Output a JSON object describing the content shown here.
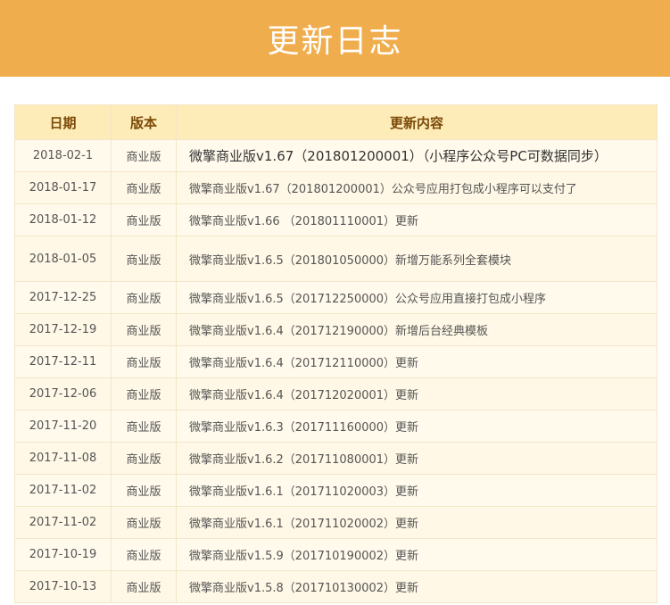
{
  "header": {
    "title": "更新日志"
  },
  "table": {
    "columns": [
      "日期",
      "版本",
      "更新内容"
    ],
    "rows": [
      {
        "date": "2018-02-1",
        "edition": "商业版",
        "content": "微擎商业版v1.67（201801200001）（小程序公众号PC可数据同步）"
      },
      {
        "date": "2018-01-17",
        "edition": "商业版",
        "content": "微擎商业版v1.67（201801200001）公众号应用打包成小程序可以支付了"
      },
      {
        "date": "2018-01-12",
        "edition": "商业版",
        "content": "微擎商业版v1.66 （201801110001）更新"
      },
      {
        "date": "2018-01-05",
        "edition": "商业版",
        "content": "微擎商业版v1.6.5（201801050000）新增万能系列全套模块"
      },
      {
        "date": "2017-12-25",
        "edition": "商业版",
        "content": "微擎商业版v1.6.5（201712250000）公众号应用直接打包成小程序"
      },
      {
        "date": "2017-12-19",
        "edition": "商业版",
        "content": "微擎商业版v1.6.4（201712190000）新增后台经典模板"
      },
      {
        "date": "2017-12-11",
        "edition": "商业版",
        "content": "微擎商业版v1.6.4（201712110000）更新"
      },
      {
        "date": "2017-12-06",
        "edition": "商业版",
        "content": "微擎商业版v1.6.4（201712020001）更新"
      },
      {
        "date": "2017-11-20",
        "edition": "商业版",
        "content": "微擎商业版v1.6.3（201711160000）更新"
      },
      {
        "date": "2017-11-08",
        "edition": "商业版",
        "content": "微擎商业版v1.6.2（201711080001）更新"
      },
      {
        "date": "2017-11-02",
        "edition": "商业版",
        "content": "微擎商业版v1.6.1（201711020003）更新"
      },
      {
        "date": "2017-11-02",
        "edition": "商业版",
        "content": "微擎商业版v1.6.1（201711020002）更新"
      },
      {
        "date": "2017-10-19",
        "edition": "商业版",
        "content": "微擎商业版v1.5.9（201710190002）更新"
      },
      {
        "date": "2017-10-13",
        "edition": "商业版",
        "content": "微擎商业版v1.5.8（201710130002）更新"
      }
    ]
  },
  "colors": {
    "banner": "#f0ad4e",
    "header_row": "#fdebb8",
    "row_bg": "#fffaec",
    "border": "#f3e6c8"
  }
}
